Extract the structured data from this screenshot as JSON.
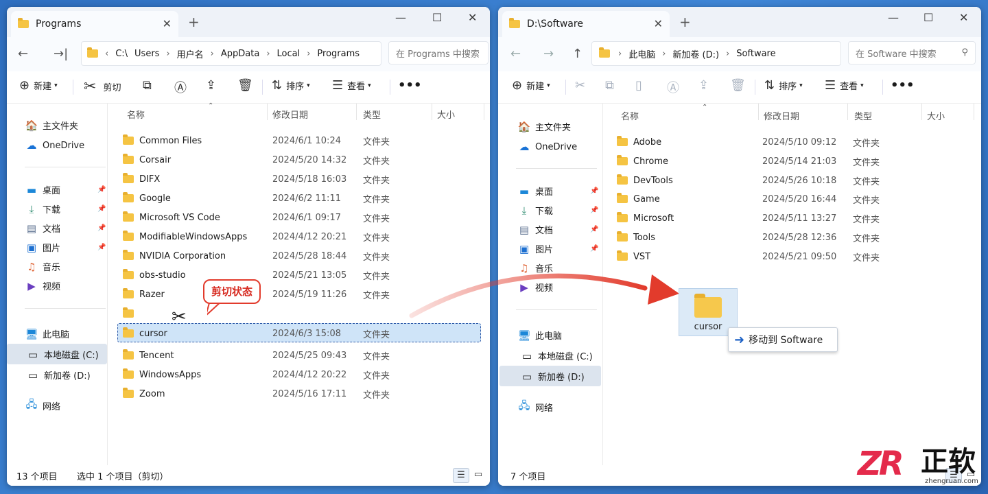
{
  "left": {
    "tab_title": "Programs",
    "path": [
      "C:\\",
      "Users",
      "用户名",
      "AppData",
      "Local",
      "Programs"
    ],
    "search_placeholder": "在 Programs 中搜索",
    "toolbar": {
      "new": "新建",
      "cut": "剪切",
      "sort": "排序",
      "view": "查看"
    },
    "sidebar": {
      "home": "主文件夹",
      "onedrive": "OneDrive",
      "desktop": "桌面",
      "downloads": "下载",
      "documents": "文档",
      "pictures": "图片",
      "music": "音乐",
      "videos": "视频",
      "thispc": "此电脑",
      "c": "本地磁盘 (C:)",
      "d": "新加卷 (D:)",
      "network": "网络"
    },
    "columns": [
      "名称",
      "修改日期",
      "类型",
      "大小"
    ],
    "files": [
      {
        "name": "Common Files",
        "date": "2024/6/1 10:24",
        "type": "文件夹"
      },
      {
        "name": "Corsair",
        "date": "2024/5/20 14:32",
        "type": "文件夹"
      },
      {
        "name": "DIFX",
        "date": "2024/5/18 16:03",
        "type": "文件夹"
      },
      {
        "name": "Google",
        "date": "2024/6/2 11:11",
        "type": "文件夹"
      },
      {
        "name": "Microsoft VS Code",
        "date": "2024/6/1 09:17",
        "type": "文件夹"
      },
      {
        "name": "ModifiableWindowsApps",
        "date": "2024/4/12 20:21",
        "type": "文件夹"
      },
      {
        "name": "NVIDIA Corporation",
        "date": "2024/5/28 18:44",
        "type": "文件夹"
      },
      {
        "name": "obs-studio",
        "date": "2024/5/21 13:05",
        "type": "文件夹"
      },
      {
        "name": "Razer",
        "date": "2024/5/19 11:26",
        "type": "文件夹"
      },
      {
        "name": "",
        "date": "",
        "type": ""
      },
      {
        "name": "cursor",
        "date": "2024/6/3 15:08",
        "type": "文件夹"
      },
      {
        "name": "Tencent",
        "date": "2024/5/25 09:43",
        "type": "文件夹"
      },
      {
        "name": "WindowsApps",
        "date": "2024/4/12 20:22",
        "type": "文件夹"
      },
      {
        "name": "Zoom",
        "date": "2024/5/16 17:11",
        "type": "文件夹"
      }
    ],
    "status_count": "13 个项目",
    "status_selected": "选中 1 个项目（剪切）",
    "callout": "剪切状态"
  },
  "right": {
    "tab_title": "D:\\Software",
    "path": [
      "此电脑",
      "新加卷 (D:)",
      "Software"
    ],
    "search_placeholder": "在 Software 中搜索",
    "toolbar": {
      "new": "新建",
      "sort": "排序",
      "view": "查看"
    },
    "sidebar": {
      "home": "主文件夹",
      "onedrive": "OneDrive",
      "desktop": "桌面",
      "downloads": "下载",
      "documents": "文档",
      "pictures": "图片",
      "music": "音乐",
      "videos": "视频",
      "thispc": "此电脑",
      "c": "本地磁盘 (C:)",
      "d": "新加卷 (D:)",
      "network": "网络"
    },
    "columns": [
      "名称",
      "修改日期",
      "类型",
      "大小"
    ],
    "files": [
      {
        "name": "Adobe",
        "date": "2024/5/10 09:12",
        "type": "文件夹"
      },
      {
        "name": "Chrome",
        "date": "2024/5/14 21:03",
        "type": "文件夹"
      },
      {
        "name": "DevTools",
        "date": "2024/5/26 10:18",
        "type": "文件夹"
      },
      {
        "name": "Game",
        "date": "2024/5/20 16:44",
        "type": "文件夹"
      },
      {
        "name": "Microsoft",
        "date": "2024/5/11 13:27",
        "type": "文件夹"
      },
      {
        "name": "Tools",
        "date": "2024/5/28 12:36",
        "type": "文件夹"
      },
      {
        "name": "VST",
        "date": "2024/5/21 09:50",
        "type": "文件夹"
      }
    ],
    "drag_label": "cursor",
    "tooltip": "移动到 Software",
    "status_count": "7 个项目"
  },
  "logo": {
    "zh": "正软",
    "en": "zhengruan.com"
  },
  "colors": {
    "accent": "#1f63c6",
    "cut_border": "#2e5aa8",
    "callout": "#e23b2c",
    "logo_red": "#e42a4b"
  }
}
